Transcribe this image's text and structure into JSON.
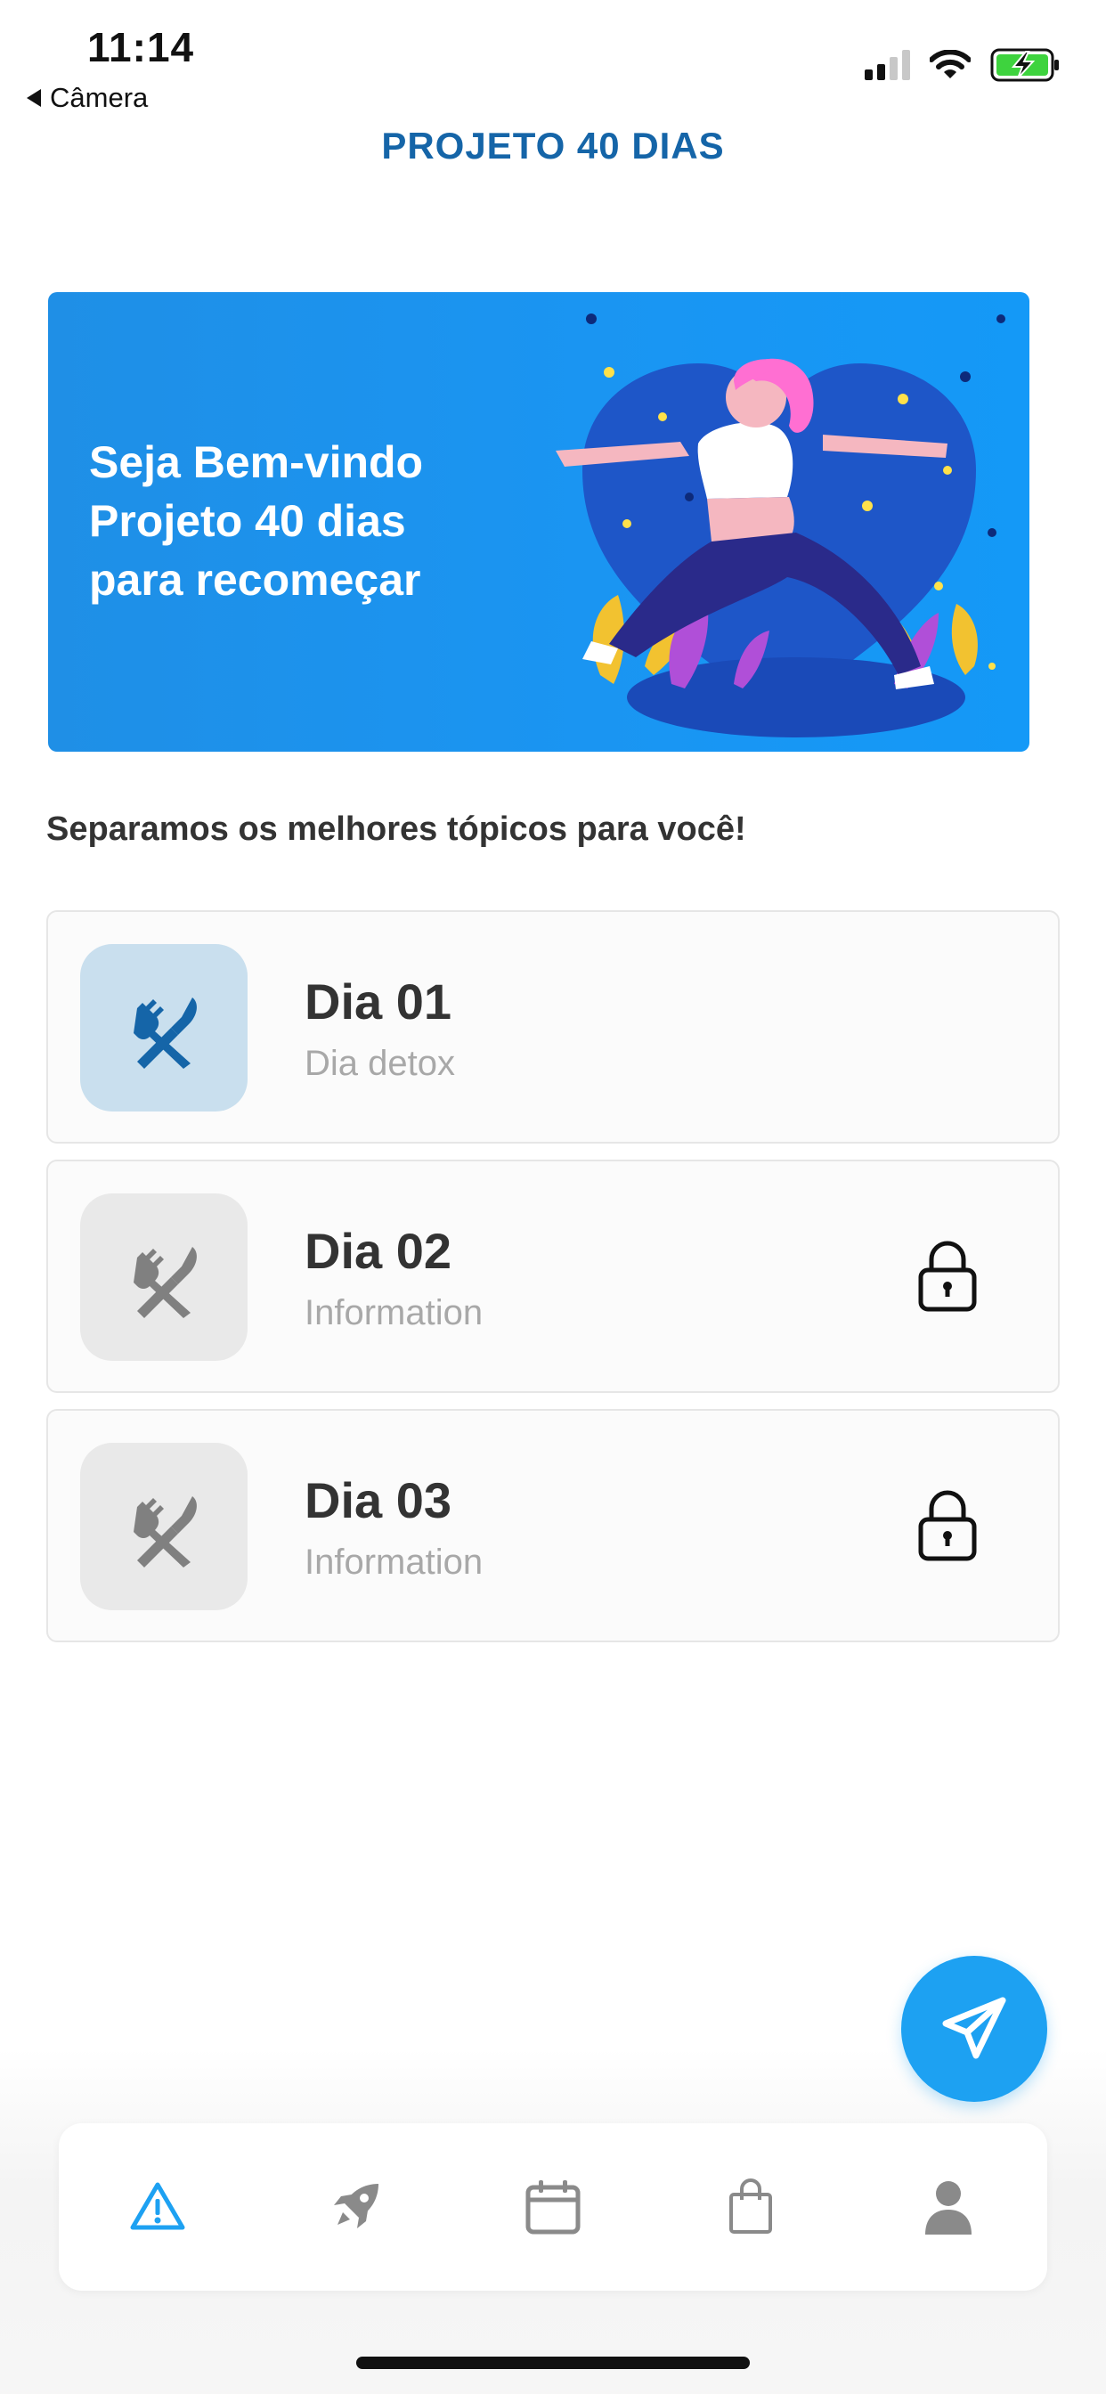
{
  "status_bar": {
    "time": "11:14",
    "back_label": "Câmera"
  },
  "header": {
    "title": "PROJETO 40 DIAS"
  },
  "banner": {
    "lines": [
      "Seja Bem-vindo",
      "Projeto 40 dias",
      "para recomeçar"
    ],
    "illustration": "yoga-woman-heart-illustration"
  },
  "section": {
    "heading": "Separamos os melhores tópicos para você!"
  },
  "days": [
    {
      "title": "Dia 01",
      "subtitle": "Dia detox",
      "locked": false,
      "icon": "fork-knife-icon"
    },
    {
      "title": "Dia 02",
      "subtitle": "Information",
      "locked": true,
      "icon": "fork-knife-icon"
    },
    {
      "title": "Dia 03",
      "subtitle": "Information",
      "locked": true,
      "icon": "fork-knife-icon"
    }
  ],
  "fab": {
    "icon": "send-icon"
  },
  "bottom_nav": {
    "items": [
      {
        "name": "alert",
        "icon": "warning-icon",
        "active": true
      },
      {
        "name": "rocket",
        "icon": "rocket-icon",
        "active": false
      },
      {
        "name": "calendar",
        "icon": "calendar-icon",
        "active": false
      },
      {
        "name": "shopping",
        "icon": "shopping-bag-icon",
        "active": false
      },
      {
        "name": "profile",
        "icon": "user-icon",
        "active": false
      }
    ]
  },
  "colors": {
    "primary": "#1da1f2",
    "title_blue": "#1565a8",
    "banner_blue": "#1a95f2",
    "active_thumb": "#c9dfee",
    "locked_thumb": "#e9e9e9",
    "icon_gray": "#808080"
  }
}
